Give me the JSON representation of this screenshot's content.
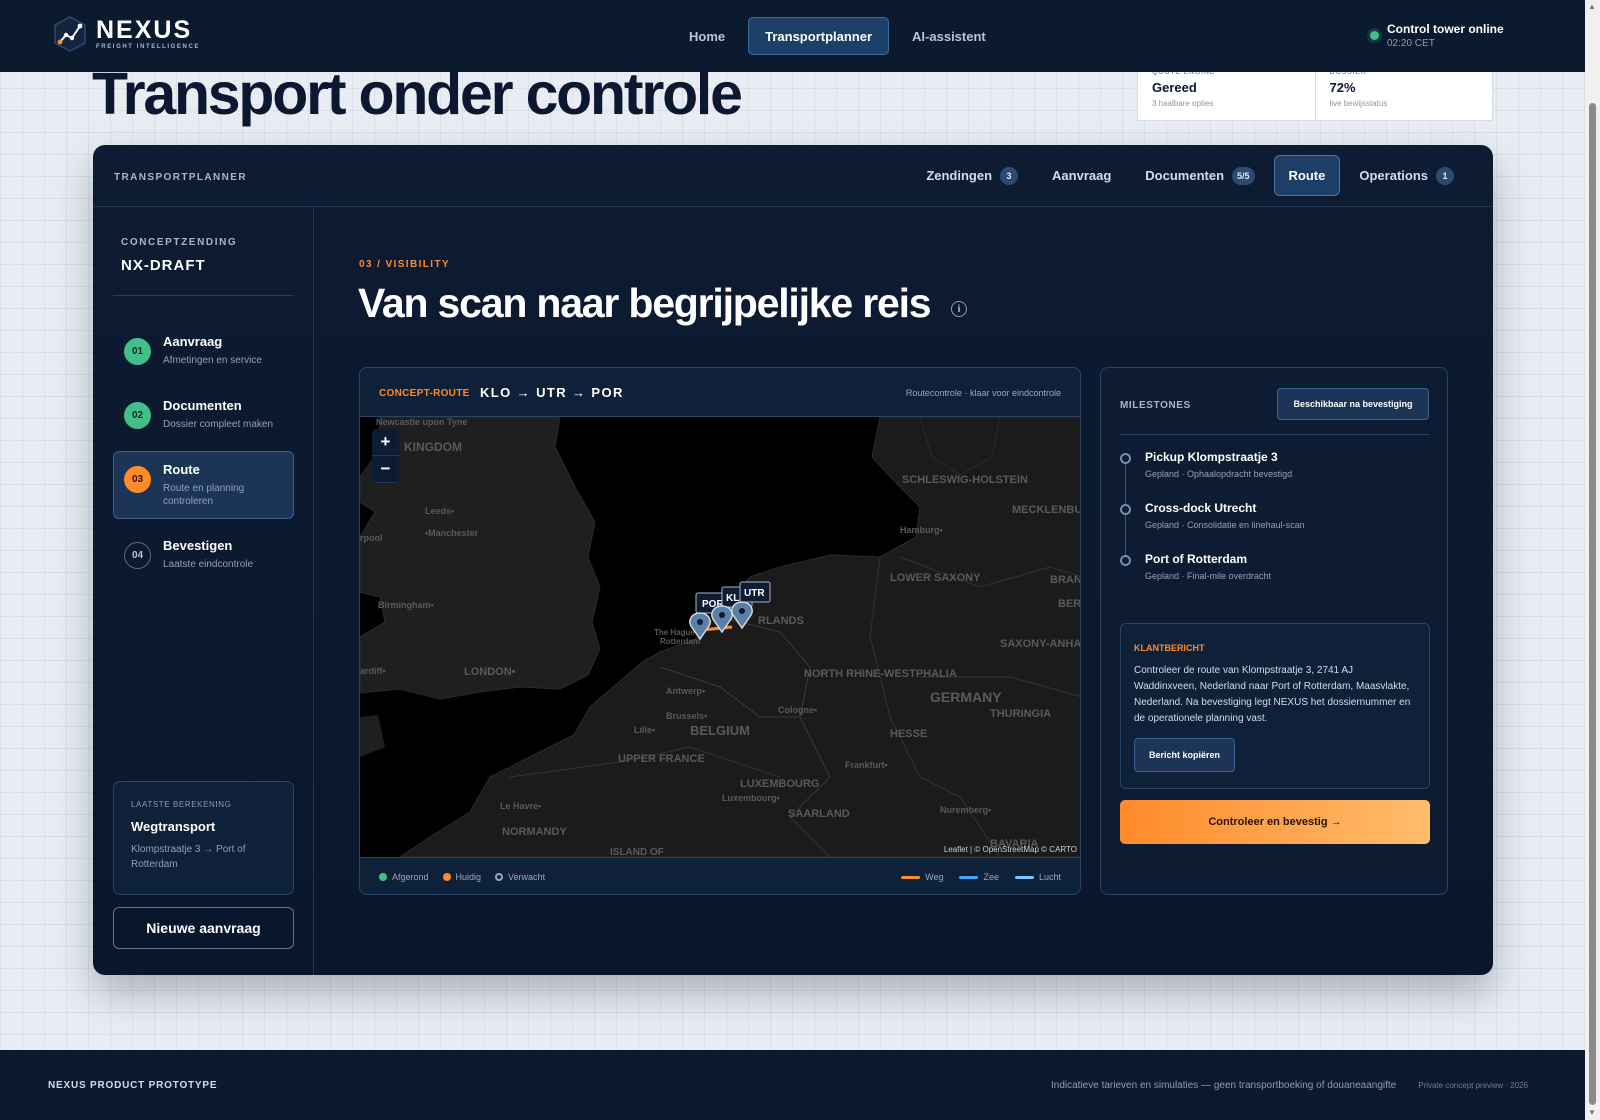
{
  "nav": {
    "brand_name": "NEXUS",
    "brand_tagline": "FREIGHT INTELLIGENCE",
    "links": [
      {
        "label": "Home"
      },
      {
        "label": "Transportplanner",
        "active": true
      },
      {
        "label": "AI-assistent"
      }
    ],
    "status_title": "Control tower online",
    "status_time": "02:20 CET"
  },
  "hero": {
    "title": "Transport onder controle",
    "kpis": [
      {
        "label": "QUOTE ENGINE",
        "value": "Gereed",
        "sub": "3 haalbare opties"
      },
      {
        "label": "DOSSIER",
        "value": "72%",
        "sub": "live bewijsstatus"
      }
    ]
  },
  "panel": {
    "label": "TRANSPORTPLANNER",
    "tabs": [
      {
        "label": "Zendingen",
        "badge": "3"
      },
      {
        "label": "Aanvraag",
        "badge": ""
      },
      {
        "label": "Documenten",
        "badge": "5/5"
      },
      {
        "label": "Route",
        "badge": "",
        "active": true
      },
      {
        "label": "Operations",
        "badge": "1"
      }
    ]
  },
  "sidebar": {
    "draft_label": "CONCEPTZENDING",
    "draft_id": "NX-DRAFT",
    "steps": [
      {
        "num": "01",
        "title": "Aanvraag",
        "sub": "Afmetingen en service",
        "state": "done"
      },
      {
        "num": "02",
        "title": "Documenten",
        "sub": "Dossier compleet maken",
        "state": "done"
      },
      {
        "num": "03",
        "title": "Route",
        "sub": "Route en planning controleren",
        "state": "current"
      },
      {
        "num": "04",
        "title": "Bevestigen",
        "sub": "Laatste eindcontrole",
        "state": "todo"
      }
    ],
    "calc_label": "LAATSTE BEREKENING",
    "calc_title": "Wegtransport",
    "calc_sub": "Klompstraatje 3 → Port of Rotterdam",
    "new_request": "Nieuwe aanvraag"
  },
  "main": {
    "eyebrow": "03 / VISIBILITY",
    "title": "Van scan naar begrijpelijke reis",
    "info_icon": "i"
  },
  "map_card": {
    "route_tag": "CONCEPT-ROUTE",
    "route_code": "KLO → UTR → POR",
    "route_note": "Routecontrole · klaar voor eindcontrole",
    "zoom_in": "+",
    "zoom_out": "−",
    "attribution": "Leaflet | © OpenStreetMap © CARTO",
    "markers": [
      "POR",
      "KLO",
      "UTR"
    ],
    "places": [
      "Newcastle upon Tyne",
      "KINGDOM",
      "Leeds•",
      "•Manchester",
      "rpool",
      "Birmingham•",
      "ardiff•",
      "LONDON•",
      "The Hague",
      "Rotterdam",
      "RLANDS",
      "Antwerp•",
      "Brussels•",
      "BELGIUM",
      "Lille•",
      "UPPER FRANCE",
      "Le Havre•",
      "NORMANDY",
      "ISLAND OF",
      "LUXEMBOURG",
      "Luxembourg•",
      "SAARLAND",
      "Cologne•",
      "NORTH RHINE-WESTPHALIA",
      "Frankfurt•",
      "HESSE",
      "GERMANY",
      "THURINGIA",
      "SAXONY-ANHALT",
      "LOWER SAXONY",
      "Hamburg•",
      "SCHLESWIG-HOLSTEIN",
      "MECKLENBURG-VORPOMM",
      "BRAND",
      "BERLI",
      "Nuremberg•",
      "BAVARIA"
    ],
    "legend_status": [
      {
        "label": "Afgerond",
        "color": "#43c08a",
        "style": "dot"
      },
      {
        "label": "Huidig",
        "color": "#ff8a2a",
        "style": "dot"
      },
      {
        "label": "Verwacht",
        "color": "#9aa8bc",
        "style": "ring"
      }
    ],
    "legend_modes": [
      {
        "label": "Weg",
        "color": "#ff8a2a"
      },
      {
        "label": "Zee",
        "color": "#4aa3ff"
      },
      {
        "label": "Lucht",
        "color": "#7cc4ff"
      }
    ]
  },
  "milestones": {
    "label": "MILESTONES",
    "button": "Beschikbaar na bevestiging",
    "items": [
      {
        "title": "Pickup Klompstraatje 3",
        "sub": "Gepland · Ophaalopdracht bevestigd"
      },
      {
        "title": "Cross-dock Utrecht",
        "sub": "Gepland · Consolidatie en linehaul-scan"
      },
      {
        "title": "Port of Rotterdam",
        "sub": "Gepland · Final-mile overdracht"
      }
    ],
    "message_label": "KLANTBERICHT",
    "message_text": "Controleer de route van Klompstraatje 3, 2741 AJ Waddinxveen, Nederland naar Port of Rotterdam, Maasvlakte, Nederland. Na bevestiging legt NEXUS het dossiernummer en de operationele planning vast.",
    "copy_button": "Bericht kopiëren",
    "confirm_button": "Controleer en bevestig →"
  },
  "footer": {
    "left": "NEXUS PRODUCT PROTOTYPE",
    "note": "Indicatieve tarieven en simulaties — geen transportboeking of douaneaangifte",
    "preview": "Private concept preview · 2026"
  },
  "colors": {
    "brand_navy": "#0c1a2f",
    "accent_orange": "#ff8a2a",
    "success_green": "#43c08a",
    "tab_active": "#1d3f67"
  },
  "icons": {
    "brand": "nexus-graph-icon",
    "status": "online-dot-icon",
    "info": "info-circle-icon",
    "map_marker": "map-pin-icon"
  }
}
